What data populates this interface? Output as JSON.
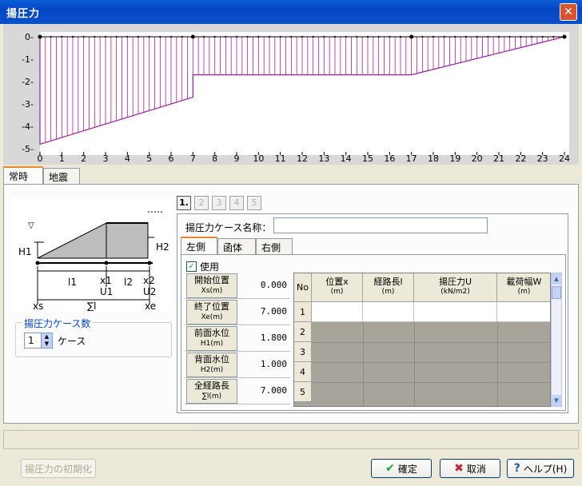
{
  "window": {
    "title": "揚圧力",
    "close_glyph": "✕"
  },
  "chart_data": {
    "type": "area",
    "title": "",
    "xlabel": "",
    "ylabel": "",
    "xlim": [
      0,
      24
    ],
    "ylim": [
      -5,
      0
    ],
    "x_ticks": [
      "0",
      "1",
      "2",
      "3",
      "4",
      "5",
      "6",
      "7",
      "8",
      "9",
      "10",
      "11",
      "12",
      "13",
      "14",
      "15",
      "16",
      "17",
      "18",
      "19",
      "20",
      "21",
      "22",
      "23",
      "24"
    ],
    "y_ticks": [
      "0-",
      "-1-",
      "-2-",
      "-3-",
      "-4-",
      "-5-"
    ],
    "series": [
      {
        "x": [
          0,
          7,
          7,
          17,
          24
        ],
        "y": [
          -4.8,
          -2.7,
          -1.7,
          -1.7,
          0
        ]
      }
    ],
    "colors": {
      "fill_lines": "#A020A0",
      "background": "#D8D8D8"
    }
  },
  "tabs_top": [
    "常時",
    "地震時"
  ],
  "diagram": {
    "labels": {
      "h1": "H1",
      "h2": "H2",
      "l1": "l1",
      "l2": "l2",
      "x1": "x1",
      "x2": "x2",
      "u1": "U1",
      "u2": "U2",
      "xs": "xs",
      "xe": "xe",
      "sum_l": "∑l",
      "water": "▽"
    }
  },
  "case_count": {
    "legend": "揚圧力ケース数",
    "value": "1",
    "unit": "ケース"
  },
  "case_tabs": [
    "1.",
    "2",
    "3",
    "4",
    "5"
  ],
  "case_name": {
    "label": "揚圧力ケース名称：",
    "value": ""
  },
  "side_tabs": [
    "左側",
    "函体",
    "右側"
  ],
  "use_checkbox": {
    "label": "使用",
    "checked": "✓"
  },
  "params": [
    {
      "label": "開始位置",
      "sub": "Xs(m)",
      "value": "0.000"
    },
    {
      "label": "終了位置",
      "sub": "Xe(m)",
      "value": "7.000"
    },
    {
      "label": "前面水位",
      "sub": "H1(m)",
      "value": "1.800"
    },
    {
      "label": "背面水位",
      "sub": "H2(m)",
      "value": "1.000"
    },
    {
      "label": "全経路長",
      "sub": "∑l(m)",
      "value": "7.000"
    }
  ],
  "grid": {
    "headers": [
      {
        "label": "No",
        "sub": ""
      },
      {
        "label": "位置x",
        "sub": "(m)"
      },
      {
        "label": "経路長l",
        "sub": "(m)"
      },
      {
        "label": "揚圧力U",
        "sub": "(kN/m2)"
      },
      {
        "label": "載荷幅W",
        "sub": "(m)"
      }
    ],
    "rows": [
      "1",
      "2",
      "3",
      "4",
      "5"
    ]
  },
  "buttons": {
    "reset": "揚圧力の初期化",
    "ok": "確定",
    "cancel": "取消",
    "help": "ヘルプ(H)"
  }
}
